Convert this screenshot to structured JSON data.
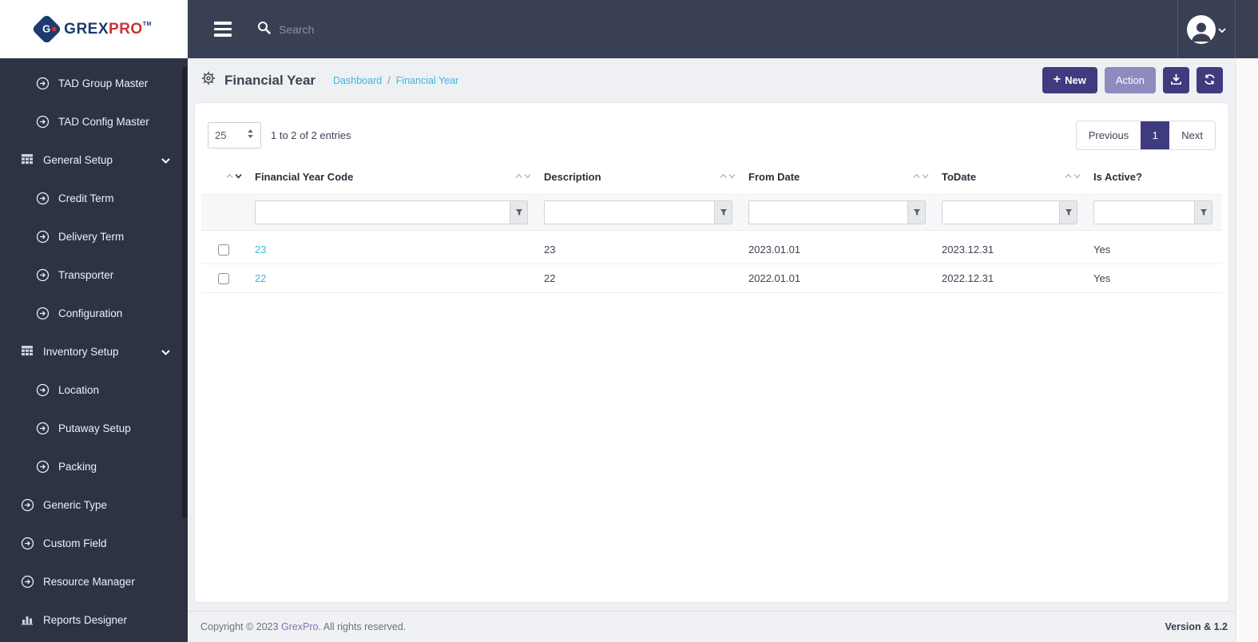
{
  "brand": {
    "logo_letter": "G",
    "text_primary": "GREX",
    "text_secondary": "PRO",
    "tm": "TM"
  },
  "topbar": {
    "search_placeholder": "Search"
  },
  "sidebar": {
    "items": [
      {
        "label": "TAD Group Master",
        "icon": "arrow-circle",
        "level": 1
      },
      {
        "label": "TAD Config Master",
        "icon": "arrow-circle",
        "level": 1
      },
      {
        "label": "General Setup",
        "icon": "grid",
        "level": 0,
        "expanded": true
      },
      {
        "label": "Credit Term",
        "icon": "arrow-circle",
        "level": 1
      },
      {
        "label": "Delivery Term",
        "icon": "arrow-circle",
        "level": 1
      },
      {
        "label": "Transporter",
        "icon": "arrow-circle",
        "level": 1
      },
      {
        "label": "Configuration",
        "icon": "arrow-circle",
        "level": 1
      },
      {
        "label": "Inventory Setup",
        "icon": "grid",
        "level": 0,
        "expanded": true
      },
      {
        "label": "Location",
        "icon": "arrow-circle",
        "level": 1
      },
      {
        "label": "Putaway Setup",
        "icon": "arrow-circle",
        "level": 1
      },
      {
        "label": "Packing",
        "icon": "arrow-circle",
        "level": 1
      },
      {
        "label": "Generic Type",
        "icon": "arrow-circle",
        "level": 0
      },
      {
        "label": "Custom Field",
        "icon": "arrow-circle",
        "level": 0
      },
      {
        "label": "Resource Manager",
        "icon": "arrow-circle",
        "level": 0
      },
      {
        "label": "Reports Designer",
        "icon": "bar-chart",
        "level": 0
      }
    ]
  },
  "page_header": {
    "title": "Financial Year",
    "breadcrumb": {
      "items": [
        "Dashboard",
        "Financial Year"
      ],
      "separator": "/"
    },
    "buttons": {
      "new_label": "New",
      "action_label": "Action"
    }
  },
  "icons": {
    "plus": "+"
  },
  "toolbar": {
    "page_size": "25",
    "entries_info": "1 to 2 of 2 entries"
  },
  "pagination": {
    "previous": "Previous",
    "current": "1",
    "next": "Next"
  },
  "table": {
    "columns": [
      {
        "label": "Financial Year Code",
        "sort": "desc"
      },
      {
        "label": "Description",
        "sort": "none"
      },
      {
        "label": "From Date",
        "sort": "none"
      },
      {
        "label": "ToDate",
        "sort": "none"
      },
      {
        "label": "Is Active?",
        "sort": "none"
      }
    ],
    "rows": [
      {
        "financial_year_code": "23",
        "description": "23",
        "from_date": "2023.01.01",
        "to_date": "2023.12.31",
        "is_active": "Yes"
      },
      {
        "financial_year_code": "22",
        "description": "22",
        "from_date": "2022.01.01",
        "to_date": "2022.12.31",
        "is_active": "Yes"
      }
    ]
  },
  "footer": {
    "copyright_prefix": "Copyright © 2023 ",
    "brand_link": "GrexPro",
    "copyright_suffix": ". All rights reserved.",
    "version": "Version & 1.2"
  },
  "colors": {
    "topbar": "#3a4053",
    "sidebar": "#2e3344",
    "accent": "#3f3b7f",
    "accent_muted": "#8f8bbf",
    "link_blue": "#41b3e3",
    "footer_link": "#7d73b5",
    "logo_navy": "#1e3a6e",
    "logo_red": "#d32f2f"
  }
}
